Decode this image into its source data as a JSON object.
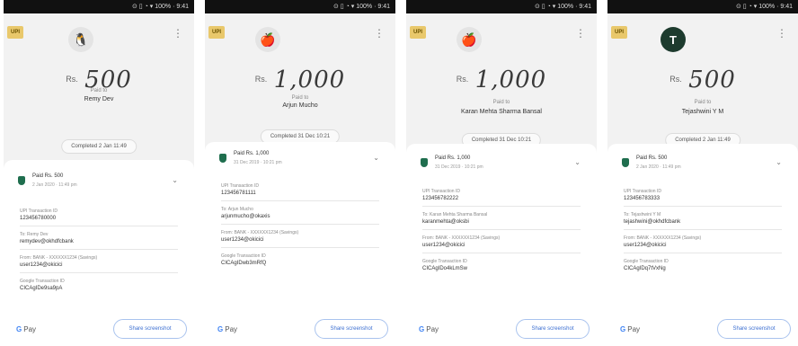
{
  "colors": {
    "accent": "#3c6fd1",
    "shield": "#1f6e4e",
    "status_bar": "#111111",
    "brand_chip": "#e9c86b"
  },
  "statusbar": {
    "text": "⊙ ▯ ◔ ▾ 100% · 9:41"
  },
  "brand_chip_text": "UPI",
  "kebab": "⋮",
  "gpay_label": "Pay",
  "share_label": "Share screenshot",
  "panels": [
    {
      "avatar": "🐧",
      "avatar_dark": false,
      "currency": "Rs.",
      "amount": "500",
      "to_label": "Paid to",
      "payee": "Remy Dev",
      "pill_button": "Completed 2 Jan 11:49",
      "summary_title": "Paid Rs. 500",
      "summary_sub": "2 Jan 2020 · 11:49 pm",
      "fields": [
        {
          "label": "UPI Transaction ID",
          "value": "123456780000"
        },
        {
          "label": "To: Remy Dev",
          "value": "remydev@okhdfcbank"
        },
        {
          "label": "From: BANK - XXXXXX1234 (Savings)",
          "value": "user1234@okicici"
        },
        {
          "label": "Google Transaction ID",
          "value": "CICAgIDe9sa9pA"
        }
      ]
    },
    {
      "avatar": "🍎",
      "avatar_dark": false,
      "currency": "Rs.",
      "amount": "1,000",
      "to_label": "Paid to",
      "payee": "Arjun Mucho",
      "pill_button": "Completed 31 Dec 10:21",
      "summary_title": "Paid Rs. 1,000",
      "summary_sub": "31 Dec 2019 · 10:21 pm",
      "fields": [
        {
          "label": "UPI Transaction ID",
          "value": "123456781111"
        },
        {
          "label": "To: Arjun Mucho",
          "value": "arjunmucho@okaxis"
        },
        {
          "label": "From: BANK - XXXXXX1234 (Savings)",
          "value": "user1234@okicici"
        },
        {
          "label": "Google Transaction ID",
          "value": "CICAgIDwb3mRfQ"
        }
      ]
    },
    {
      "avatar": "🍎",
      "avatar_dark": false,
      "currency": "Rs.",
      "amount": "1,000",
      "to_label": "Paid to",
      "payee": "Karan Mehta Sharma Bansal",
      "pill_button": "Completed 31 Dec 10:21",
      "summary_title": "Paid Rs. 1,000",
      "summary_sub": "31 Dec 2019 · 10:21 pm",
      "fields": [
        {
          "label": "UPI Transaction ID",
          "value": "123456782222"
        },
        {
          "label": "To: Karan Mehta Sharma Bansal",
          "value": "karanmehta@oksbi"
        },
        {
          "label": "From: BANK - XXXXXX1234 (Savings)",
          "value": "user1234@okicici"
        },
        {
          "label": "Google Transaction ID",
          "value": "CICAgIDo4kLmSw"
        }
      ]
    },
    {
      "avatar": "T",
      "avatar_dark": true,
      "currency": "Rs.",
      "amount": "500",
      "to_label": "Paid to",
      "payee": "Tejashwini Y M",
      "pill_button": "Completed 2 Jan 11:49",
      "summary_title": "Paid Rs. 500",
      "summary_sub": "2 Jan 2020 · 11:49 pm",
      "fields": [
        {
          "label": "UPI Transaction ID",
          "value": "123456783333"
        },
        {
          "label": "To: Tejashwini Y M",
          "value": "tejashwini@okhdfcbank"
        },
        {
          "label": "From: BANK - XXXXXX1234 (Savings)",
          "value": "user1234@okicici"
        },
        {
          "label": "Google Transaction ID",
          "value": "CICAgIDq7tVxNg"
        }
      ]
    }
  ]
}
